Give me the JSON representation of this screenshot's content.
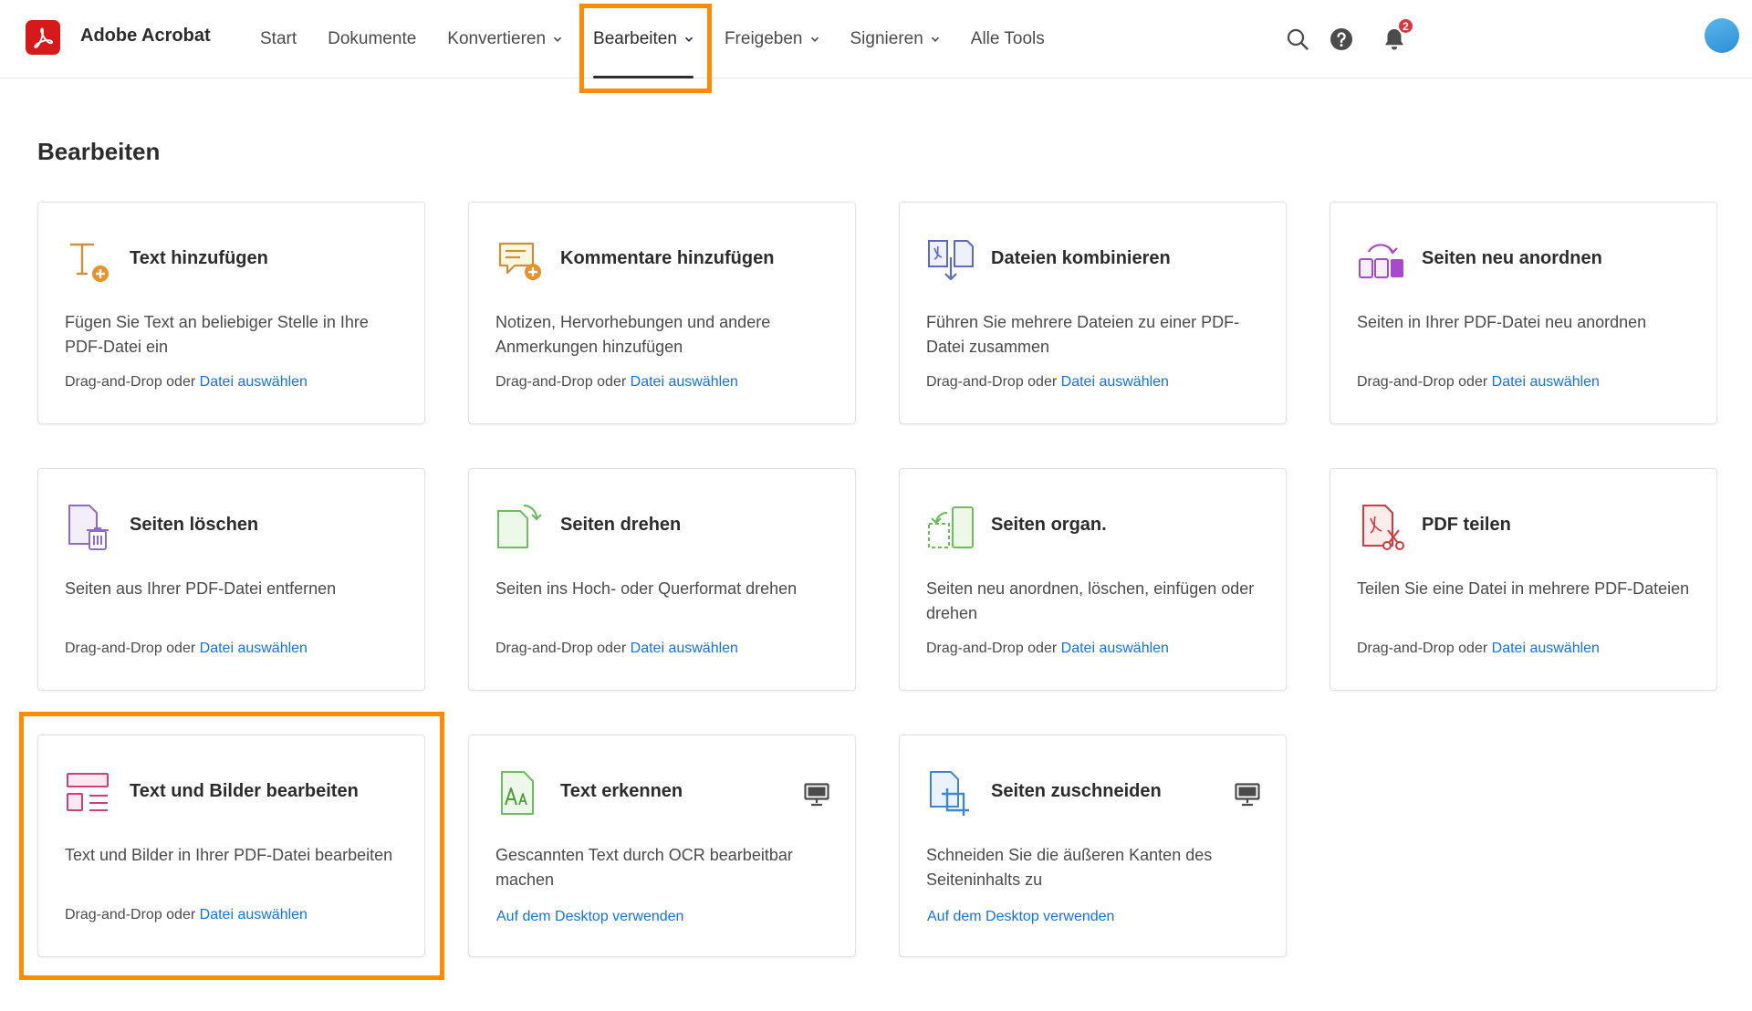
{
  "app": {
    "name": "Adobe Acrobat"
  },
  "nav": {
    "items": [
      {
        "label": "Start"
      },
      {
        "label": "Dokumente"
      },
      {
        "label": "Konvertieren"
      },
      {
        "label": "Bearbeiten"
      },
      {
        "label": "Freigeben"
      },
      {
        "label": "Signieren"
      },
      {
        "label": "Alle Tools"
      }
    ],
    "active": "Bearbeiten"
  },
  "header": {
    "notification_count": "2"
  },
  "page": {
    "title": "Bearbeiten"
  },
  "cards": [
    {
      "title": "Text hinzufügen",
      "desc": "Fügen Sie Text an beliebiger Stelle in Ihre PDF-Datei ein",
      "drag": "Drag-and-Drop oder",
      "link": "Datei auswählen",
      "icon": "add-text-icon"
    },
    {
      "title": "Kommentare hinzufügen",
      "desc": "Notizen, Hervorhebungen und andere Anmerkungen hinzufügen",
      "drag": "Drag-and-Drop oder",
      "link": "Datei auswählen",
      "icon": "add-comment-icon"
    },
    {
      "title": "Dateien kombinieren",
      "desc": "Führen Sie mehrere Dateien zu einer PDF-Datei zusammen",
      "drag": "Drag-and-Drop oder",
      "link": "Datei auswählen",
      "icon": "combine-files-icon"
    },
    {
      "title": "Seiten neu anordnen",
      "desc": "Seiten in Ihrer PDF-Datei neu anordnen",
      "drag": "Drag-and-Drop oder",
      "link": "Datei auswählen",
      "icon": "reorder-pages-icon"
    },
    {
      "title": "Seiten löschen",
      "desc": "Seiten aus Ihrer PDF-Datei entfernen",
      "drag": "Drag-and-Drop oder",
      "link": "Datei auswählen",
      "icon": "delete-pages-icon"
    },
    {
      "title": "Seiten drehen",
      "desc": "Seiten ins Hoch- oder Querformat drehen",
      "drag": "Drag-and-Drop oder",
      "link": "Datei auswählen",
      "icon": "rotate-pages-icon"
    },
    {
      "title": "Seiten organ.",
      "desc": "Seiten neu anordnen, löschen, einfügen oder drehen",
      "drag": "Drag-and-Drop oder",
      "link": "Datei auswählen",
      "icon": "organize-pages-icon"
    },
    {
      "title": "PDF teilen",
      "desc": "Teilen Sie eine Datei in mehrere PDF-Dateien",
      "drag": "Drag-and-Drop oder",
      "link": "Datei auswählen",
      "icon": "split-pdf-icon"
    },
    {
      "title": "Text und Bilder bearbeiten",
      "desc": "Text und Bilder in Ihrer PDF-Datei bearbeiten",
      "drag": "Drag-and-Drop oder",
      "link": "Datei auswählen",
      "icon": "edit-text-images-icon"
    },
    {
      "title": "Text erkennen",
      "desc": "Gescannten Text durch OCR bearbeitbar machen",
      "link": "Auf dem Desktop verwenden",
      "icon": "recognize-text-icon"
    },
    {
      "title": "Seiten zuschneiden",
      "desc": "Schneiden Sie die äußeren Kanten des Seiteninhalts zu",
      "link": "Auf dem Desktop verwenden",
      "icon": "crop-pages-icon"
    }
  ],
  "colors": {
    "accent": "#1473e6",
    "highlight": "#ff8c00",
    "brand": "#d7191c"
  }
}
